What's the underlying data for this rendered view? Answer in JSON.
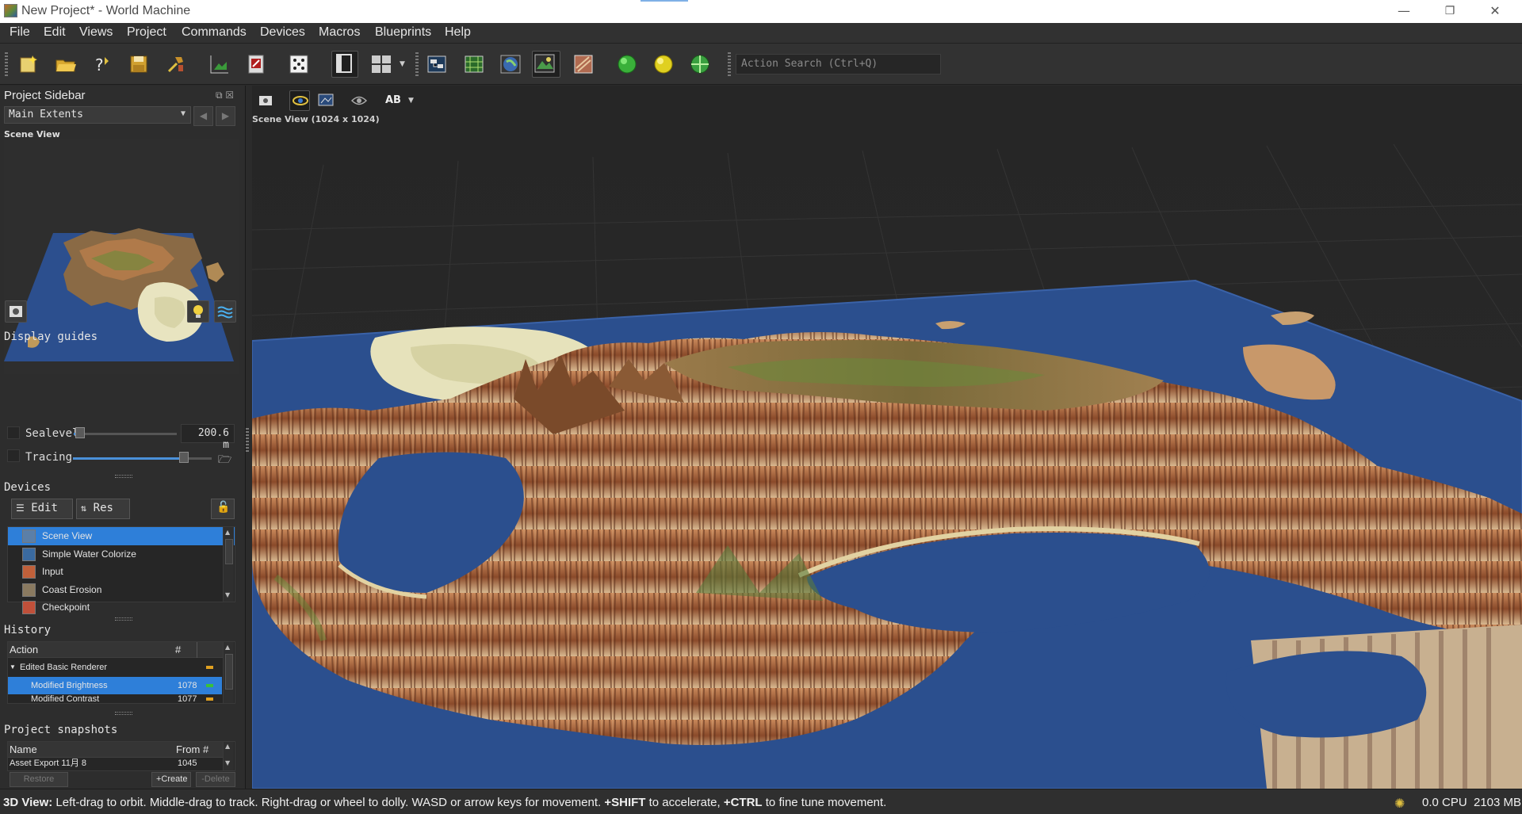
{
  "window": {
    "title": "New Project* - World Machine",
    "minimize": "—",
    "restore": "❐",
    "close": "✕"
  },
  "menu": [
    "File",
    "Edit",
    "Views",
    "Project",
    "Commands",
    "Devices",
    "Macros",
    "Blueprints",
    "Help"
  ],
  "toolbar": {
    "search_placeholder": "Action Search (Ctrl+Q)",
    "icons": [
      "new-project-icon",
      "open-project-icon",
      "help-icon",
      "save-icon",
      "tools-icon",
      "terrain-icon",
      "render-icon",
      "dice-icon",
      "single-layout-icon",
      "grid-layout-icon",
      "explorer-icon",
      "layout-view-icon",
      "globe-icon",
      "texture-view-icon",
      "material-icon",
      "build-green-icon",
      "build-yellow-icon",
      "build-world-icon"
    ]
  },
  "sidebar": {
    "title": "Project Sidebar",
    "extents": "Main Extents",
    "preview_label": "Scene View",
    "display_guides": {
      "title": "Display guides",
      "sealevel_label": "Sealevel",
      "sealevel_value": "200.6 m",
      "sealevel_fraction": 0.06,
      "tracing_label": "Tracing",
      "tracing_fraction": 0.8
    },
    "devices": {
      "title": "Devices",
      "edit_label": "Edit",
      "res_label": "Res",
      "items": [
        {
          "label": "Scene View",
          "selected": true,
          "color": "#5b7fa8"
        },
        {
          "label": "Simple Water Colorize",
          "selected": false,
          "color": "#3a6aa0"
        },
        {
          "label": "Input",
          "selected": false,
          "color": "#c0603a"
        },
        {
          "label": "Coast Erosion",
          "selected": false,
          "color": "#8a7a60"
        },
        {
          "label": "Checkpoint",
          "selected": false,
          "color": "#c0503a"
        }
      ]
    },
    "history": {
      "title": "History",
      "col_action": "Action",
      "col_num": "#",
      "rows": [
        {
          "action": "Edited Basic Renderer",
          "num": "",
          "selected": false,
          "indent": false,
          "expanded": true,
          "marker": "#e0a020"
        },
        {
          "action": "Modified Brightness",
          "num": "1078",
          "selected": true,
          "indent": true,
          "marker": "#3ac03a"
        },
        {
          "action": "Modified Contrast",
          "num": "1077",
          "selected": false,
          "indent": true,
          "marker": "#e0a020"
        }
      ]
    },
    "snapshots": {
      "title": "Project snapshots",
      "col_name": "Name",
      "col_from": "From #",
      "rows": [
        {
          "name": "Asset Export 11月 8",
          "from": "1045"
        }
      ],
      "restore_label": "Restore",
      "create_label": "+Create",
      "delete_label": "-Delete"
    }
  },
  "viewport": {
    "label": "Scene View (1024 x 1024)",
    "ab_label": "AB"
  },
  "status": {
    "label": "3D View:",
    "seg1": " Left-drag to orbit. Middle-drag to track. Right-drag or wheel to dolly. WASD or arrow keys for movement. ",
    "shift": "+SHIFT",
    "seg2": " to accelerate, ",
    "ctrl": "+CTRL",
    "seg3": " to fine tune movement.",
    "cpu": "0.0 CPU",
    "mem": "2103 MB"
  },
  "colors": {
    "accent": "#2e7fd9",
    "water": "#2a4f8c",
    "sand": "#e8e4c0",
    "rock": "#a0603a"
  }
}
